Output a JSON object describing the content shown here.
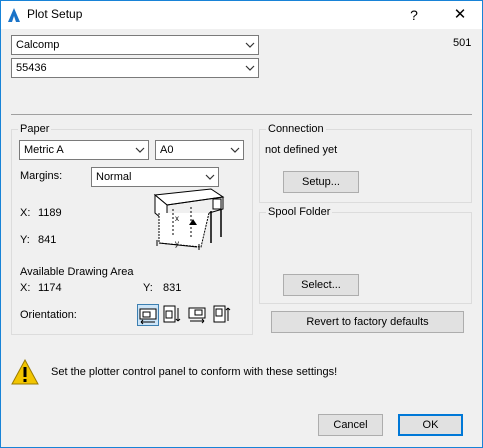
{
  "window": {
    "title": "Plot Setup",
    "help_glyph": "?",
    "close_glyph": "✕"
  },
  "device": {
    "plotter": "Calcomp",
    "model": "55436",
    "code": "501"
  },
  "paper": {
    "group_title": "Paper",
    "paper_system": "Metric A",
    "paper_size": "A0",
    "margins_label": "Margins:",
    "margins_value": "Normal",
    "x_label": "X:",
    "x_value": "1189",
    "y_label": "Y:",
    "y_value": "841",
    "available_label": "Available Drawing Area",
    "avail_x_label": "X:",
    "avail_x_value": "1174",
    "avail_y_label": "Y:",
    "avail_y_value": "831",
    "orientation_label": "Orientation:"
  },
  "connection": {
    "group_title": "Connection",
    "status": "not defined yet",
    "setup_button": "Setup..."
  },
  "spool": {
    "group_title": "Spool Folder",
    "select_button": "Select..."
  },
  "revert_button": "Revert to factory defaults",
  "warning": {
    "icon": "warning-icon",
    "text": "Set the plotter control panel to conform with these settings!"
  },
  "footer": {
    "cancel": "Cancel",
    "ok": "OK"
  },
  "colors": {
    "accent": "#0078d7",
    "title_accent": "#1883d7",
    "warning": "#f2c500"
  }
}
